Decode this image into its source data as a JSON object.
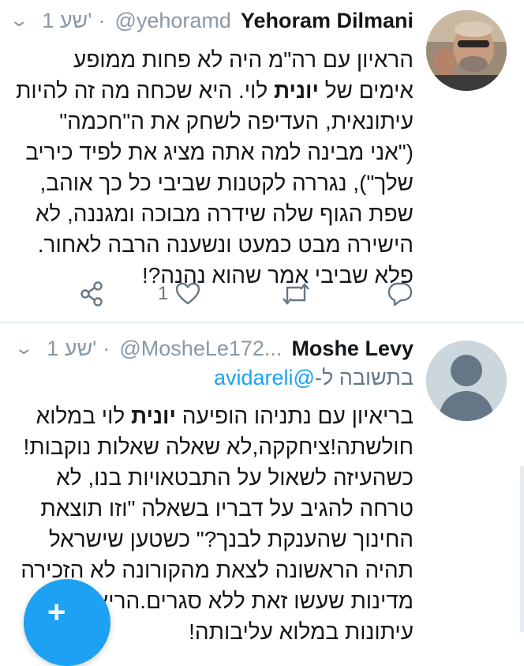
{
  "tweets": [
    {
      "display_name": "Yehoram Dilmani",
      "handle": "@yehoramd",
      "time": "1 שע'",
      "separator": "·",
      "lines": [
        "הראיון עם רה\"מ היה לא פחות ממופע",
        {
          "before": "אימים של ",
          "bold": "יונית",
          "after": " לוי. היא שכחה מה זה להיות"
        },
        "עיתונאית, העדיפה לשחק את ה\"חכמה\"",
        "(\"אני מבינה למה אתה מציג את לפיד כיריב",
        "שלך\"), נגררה לקטנות שביבי כל כך אוהב,",
        "שפת הגוף שלה שידרה מבוכה ומגננה, לא",
        "הישירה מבט כמעט ונשענה הרבה לאחור.",
        "פלא שביבי אמר שהוא נהנה?!"
      ],
      "actions": {
        "share_icon": "share-icon",
        "like_icon": "heart-icon",
        "like_count": "1",
        "retweet_icon": "retweet-icon",
        "reply_icon": "reply-icon"
      }
    },
    {
      "display_name": "Moshe Levy",
      "handle": "@MosheLe172...",
      "time": "1 שע'",
      "separator": "·",
      "reply_prefix": "בתשובה ל-",
      "reply_mention": "@avidareli",
      "lines": [
        {
          "before": "בריאיון עם נתניהו הופיעה ",
          "bold": "יונית",
          "after": " לוי במלוא"
        },
        "חולשתה!ציחקקה,לא שאלה שאלות נוקבות!",
        "כשהעיזה לשאול על התבטאויות בנו, לא",
        "טרחה להגיב על דבריו בשאלה \"וזו תוצאת",
        "החינוך שהענקת לבנך?\" כשטען שישראל",
        "תהיה הראשונה לצאת מהקורונה לא הזכירה",
        "מדינות שעשו זאת ללא סגרים.הריאיון היה",
        "עיתונות במלוא עליבותה!"
      ]
    }
  ],
  "compose_button": {
    "icon": "compose-tweet-icon",
    "glyph": "+"
  },
  "colors": {
    "accent": "#1da1f2",
    "muted": "#8899a6",
    "text": "#14171a",
    "divider": "#e6ecf0"
  }
}
